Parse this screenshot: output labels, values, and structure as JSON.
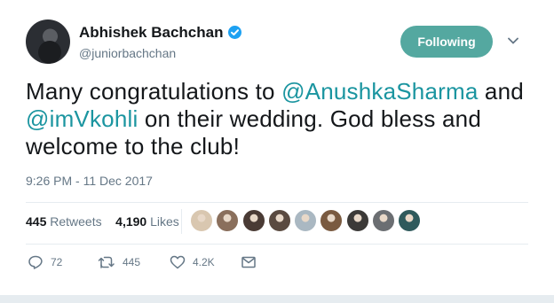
{
  "tweet": {
    "author": {
      "name": "Abhishek Bachchan",
      "handle": "@juniorbachchan",
      "verified_icon": "verified-badge-icon"
    },
    "follow_button": "Following",
    "text": {
      "part1": "Many congratulations to ",
      "mention1": "@AnushkaSharma",
      "part2": " and ",
      "mention2": "@imVkohli",
      "part3": " on their wedding. God bless and welcome to the club!"
    },
    "timestamp": "9:26 PM - 11 Dec 2017",
    "stats": {
      "retweets_count": "445",
      "retweets_label": "Retweets",
      "likes_count": "4,190",
      "likes_label": "Likes"
    },
    "likers": [
      {
        "color": "#d9c7b0"
      },
      {
        "color": "#8a6f5c"
      },
      {
        "color": "#4a3b35"
      },
      {
        "color": "#5a4a40"
      },
      {
        "color": "#aab8c2"
      },
      {
        "color": "#7a5a40"
      },
      {
        "color": "#3c3a38"
      },
      {
        "color": "#6b6e72"
      },
      {
        "color": "#2f5a5c"
      }
    ],
    "actions": {
      "reply_count": "72",
      "retweet_count": "445",
      "like_count": "4.2K"
    },
    "colors": {
      "accent": "#54a8a0",
      "mention": "#1b95a0",
      "secondary_text": "#657786",
      "verified": "#1da1f2"
    }
  }
}
